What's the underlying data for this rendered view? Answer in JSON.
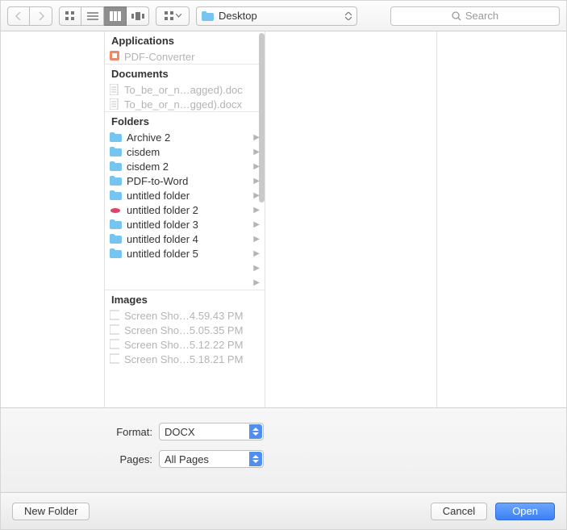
{
  "toolbar": {
    "location": "Desktop",
    "search_placeholder": "Search"
  },
  "groups": {
    "applications": {
      "header": "Applications",
      "items": [
        {
          "name": "PDF-Converter",
          "icon": "app",
          "dim": true
        }
      ]
    },
    "documents": {
      "header": "Documents",
      "items": [
        {
          "name": "To_be_or_n…agged).doc",
          "icon": "doc",
          "dim": true
        },
        {
          "name": "To_be_or_n…gged).docx",
          "icon": "doc",
          "dim": true
        }
      ]
    },
    "folders": {
      "header": "Folders",
      "items": [
        {
          "name": "Archive 2",
          "icon": "folder",
          "arrow": true
        },
        {
          "name": "cisdem",
          "icon": "folder",
          "arrow": true
        },
        {
          "name": "cisdem 2",
          "icon": "folder",
          "arrow": true
        },
        {
          "name": "PDF-to-Word",
          "icon": "folder",
          "arrow": true
        },
        {
          "name": "untitled folder",
          "icon": "folder",
          "arrow": true
        },
        {
          "name": "untitled folder 2",
          "icon": "folder-alt",
          "arrow": true
        },
        {
          "name": "untitled folder 3",
          "icon": "folder",
          "arrow": true
        },
        {
          "name": "untitled folder 4",
          "icon": "folder",
          "arrow": true
        },
        {
          "name": "untitled folder 5",
          "icon": "folder",
          "arrow": true
        },
        {
          "name": "",
          "icon": "none",
          "arrow": true
        },
        {
          "name": "",
          "icon": "none",
          "arrow": true
        }
      ]
    },
    "images": {
      "header": "Images",
      "items": [
        {
          "name": "Screen Sho…4.59.43 PM",
          "icon": "img",
          "dim": true
        },
        {
          "name": "Screen Sho…5.05.35 PM",
          "icon": "img",
          "dim": true
        },
        {
          "name": "Screen Sho…5.12.22 PM",
          "icon": "img",
          "dim": true
        },
        {
          "name": "Screen Sho…5.18.21 PM",
          "icon": "img",
          "dim": true
        }
      ]
    }
  },
  "options": {
    "format_label": "Format:",
    "format_value": "DOCX",
    "pages_label": "Pages:",
    "pages_value": "All Pages"
  },
  "buttons": {
    "new_folder": "New Folder",
    "cancel": "Cancel",
    "open": "Open"
  }
}
